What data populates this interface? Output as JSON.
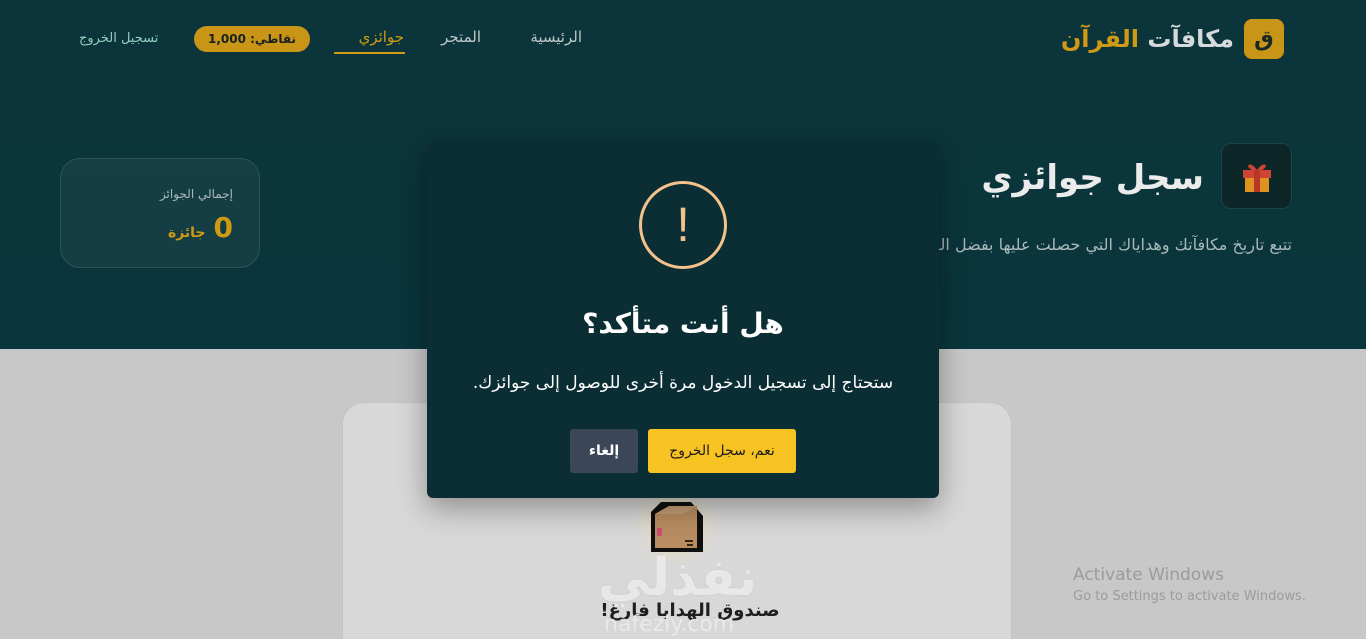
{
  "header": {
    "brand_badge": "ق",
    "brand_main": "مكافآت",
    "brand_accent": "القرآن",
    "nav": {
      "home": "الرئيسية",
      "store": "المتجر",
      "prizes": "جوائزي"
    },
    "points": "نقاطي: 1,000",
    "logout": "تسجيل الخروج"
  },
  "page": {
    "title": "سجل جوائزي",
    "description": "تتبع تاريخ مكافآتك وهداياك التي حصلت عليها بفضل القرآن.",
    "stats": {
      "label": "إجمالي الجوائز",
      "value": "0",
      "unit": "جائزة"
    },
    "empty_title": "صندوق الهدايا فارغ!"
  },
  "watermark": {
    "text": "نفذلي",
    "url": "nafezly.com"
  },
  "os_notice": {
    "line1": "Activate Windows",
    "line2": "Go to Settings to activate Windows."
  },
  "modal": {
    "icon": "!",
    "title": "هل أنت متأكد؟",
    "text": "ستحتاج إلى تسجيل الدخول مرة أخرى للوصول إلى جوائزك.",
    "confirm_label": "نعم، سجل الخروج",
    "cancel_label": "إلغاء"
  },
  "colors": {
    "accent": "#e1a816",
    "hero_bg": "#0b3a41",
    "modal_bg": "#0b2e35",
    "confirm_bg": "#f6c322",
    "cancel_bg": "#3b4658",
    "warning": "#f5c28c"
  }
}
